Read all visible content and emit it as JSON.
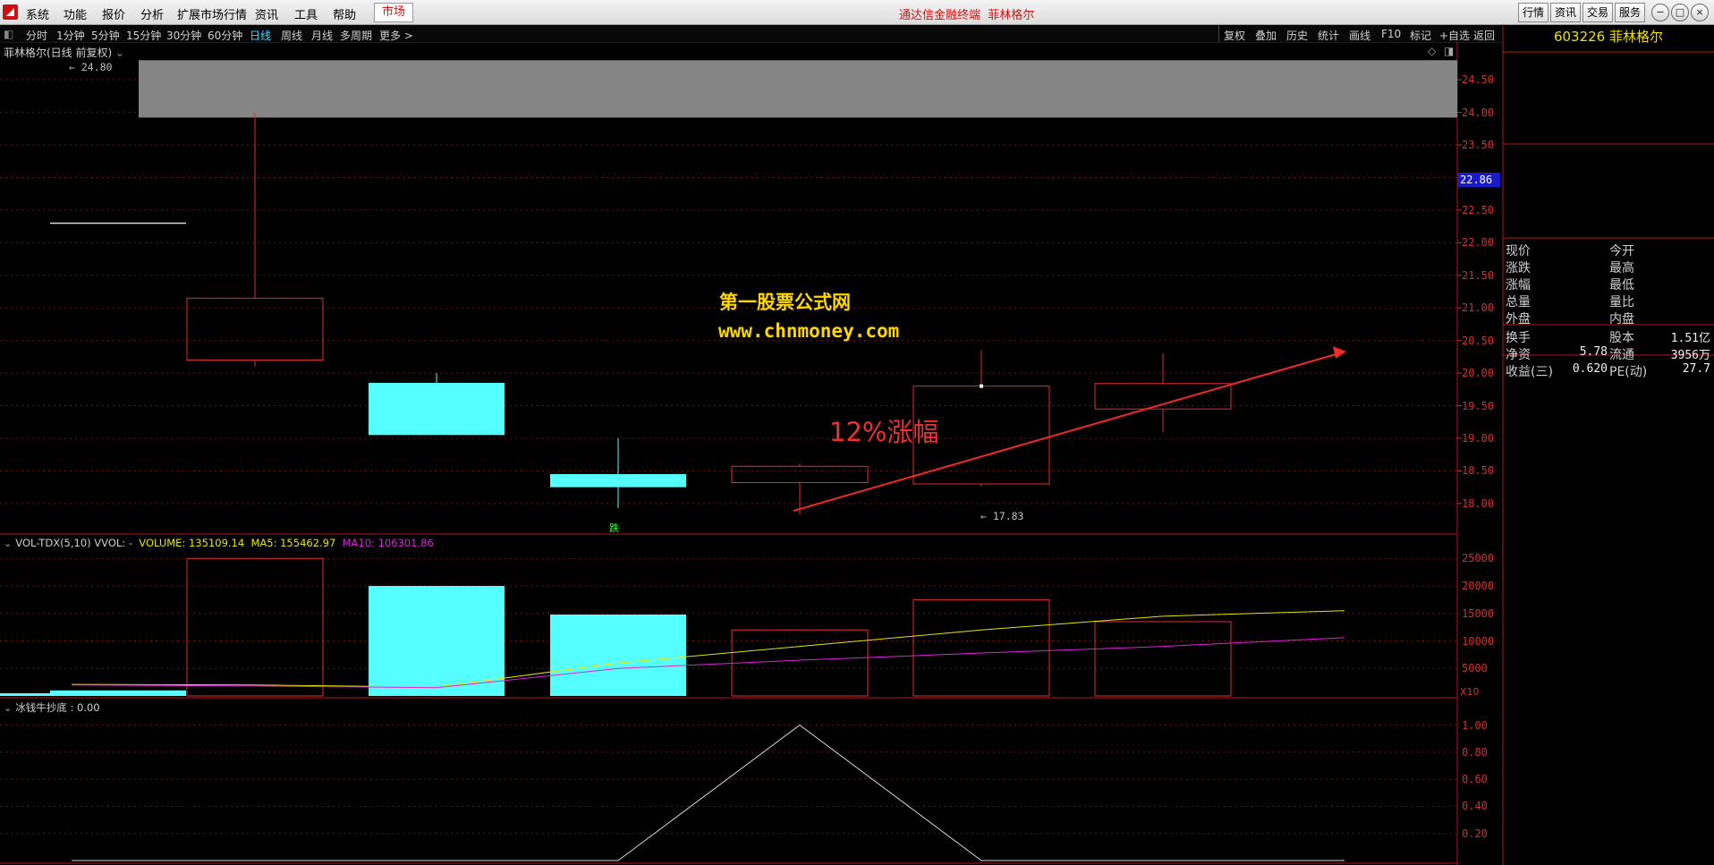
{
  "menu": {
    "items": [
      "系统",
      "功能",
      "报价",
      "分析",
      "扩展市场行情",
      "资讯",
      "工具",
      "帮助"
    ],
    "market_label": "市场",
    "app_title": "通达信金融终端",
    "stock_name_title": "菲林格尔",
    "right_buttons": [
      "行情",
      "资讯",
      "交易",
      "服务"
    ],
    "window_controls": [
      "−",
      "□",
      "×"
    ]
  },
  "toolbar": {
    "timeframes": [
      "分时",
      "1分钟",
      "5分钟",
      "15分钟",
      "30分钟",
      "60分钟",
      "日线",
      "周线",
      "月线",
      "多周期",
      "更多 >"
    ],
    "active_timeframe": "日线",
    "right_tools": [
      "复权",
      "叠加",
      "历史",
      "统计",
      "画线",
      "F10",
      "标记",
      "+自选",
      "返回"
    ]
  },
  "chart": {
    "header": "菲林格尔(日线 前复权)",
    "high_label": "24.80",
    "low_label": "17.83",
    "current_price_tag": "22.86",
    "price_ticks": [
      "24.50",
      "24.00",
      "23.50",
      "23.00",
      "22.50",
      "22.00",
      "21.50",
      "21.00",
      "20.50",
      "20.00",
      "19.50",
      "19.00",
      "18.50",
      "18.00"
    ],
    "volume_ticks": [
      "25000",
      "20000",
      "15000",
      "10000",
      "5000"
    ],
    "volume_unit": "X10",
    "indicator_ticks": [
      "1.00",
      "0.80",
      "0.60",
      "0.40",
      "0.20"
    ],
    "watermark_cn": "第一股票公式网",
    "watermark_url": "www.chnmoney.com",
    "annotation": "12%涨幅",
    "signal_text": "跌"
  },
  "volume_indicator": {
    "name": "VOL-TDX(5,10) VVOL: -",
    "volume": "VOLUME: 135109.14",
    "ma5": "MA5: 155462.97",
    "ma10": "MA10: 106301.86"
  },
  "custom_indicator": {
    "label": "冰钱牛抄底 : 0.00"
  },
  "right_panel": {
    "stock_code": "603226",
    "stock_name": "菲林格尔",
    "quote_labels_left": [
      "现价",
      "涨跌",
      "涨幅",
      "总量",
      "外盘"
    ],
    "quote_labels_right": [
      "今开",
      "最高",
      "最低",
      "量比",
      "内盘"
    ],
    "stats": [
      {
        "l1": "换手",
        "v1": "",
        "l2": "股本",
        "v2": "1.51亿"
      },
      {
        "l1": "净资",
        "v1": "5.78",
        "l2": "流通",
        "v2": "3956万"
      },
      {
        "l1": "收益(三)",
        "v1": "0.620",
        "l2": "PE(动)",
        "v2": "27.7"
      }
    ]
  },
  "colors": {
    "up": "#e03030",
    "down": "#55ffff",
    "ma5": "#e6e600",
    "ma10": "#e020e0",
    "watermark": "#ffd700",
    "axis": "#d23030"
  },
  "chart_data": {
    "type": "candlestick",
    "title": "菲林格尔(日线 前复权)",
    "ylim": [
      17.6,
      24.9
    ],
    "candles": [
      {
        "open": 22.3,
        "close": 22.3,
        "high": 22.3,
        "low": 22.3,
        "dir": "flat"
      },
      {
        "open": 20.2,
        "close": 21.15,
        "high": 24.0,
        "low": 20.1,
        "dir": "up"
      },
      {
        "open": 19.85,
        "close": 19.05,
        "high": 20.0,
        "low": 19.05,
        "dir": "down"
      },
      {
        "open": 18.45,
        "close": 18.25,
        "high": 19.0,
        "low": 17.93,
        "dir": "down"
      },
      {
        "open": 18.32,
        "close": 18.57,
        "high": 18.61,
        "low": 17.83,
        "dir": "up"
      },
      {
        "open": 18.3,
        "close": 19.8,
        "high": 20.35,
        "low": 18.26,
        "dir": "up"
      },
      {
        "open": 19.45,
        "close": 19.84,
        "high": 20.3,
        "low": 19.1,
        "dir": "up"
      }
    ],
    "volume": [
      1000,
      25000,
      20000,
      14800,
      12000,
      17500,
      13500
    ],
    "ma5": [
      2100,
      1900,
      6000,
      9000,
      12000,
      15500,
      17500
    ],
    "ma10": [
      2000,
      1800,
      5000,
      6500,
      7800,
      9000,
      10600
    ],
    "indicator": [
      0,
      0,
      0,
      1.0,
      0,
      0,
      0
    ]
  }
}
